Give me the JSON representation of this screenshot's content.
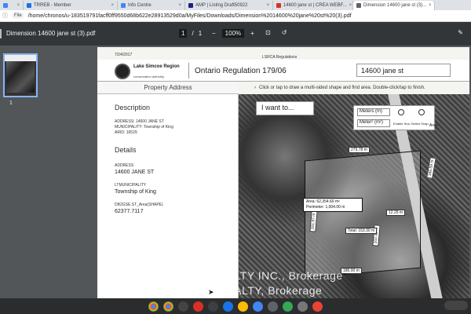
{
  "browser": {
    "tabs": [
      {
        "title": "",
        "color": "#4285f4"
      },
      {
        "title": "TRREB - Member",
        "color": "#1a73e8"
      },
      {
        "title": "Info Centre",
        "color": "#4285f4"
      },
      {
        "title": "AMP | Listing Draft50922",
        "color": "#1a237e"
      },
      {
        "title": "14600 jane st | CREA WEBF...",
        "color": "#d93025"
      },
      {
        "title": "Dimension 14600 jane st (3)...",
        "color": "#5f6368"
      }
    ],
    "address_prefix": "File",
    "address": "/home/chronos/u-183519791facff0ff9550d68b622e28913529d0a/MyFiles/Downloads/Dimension%2014600%20jane%20st%20(3).pdf"
  },
  "pdf": {
    "filename": "Dimension 14600 jane st (3).pdf",
    "page_current": "1",
    "page_sep": "/",
    "page_total": "1",
    "zoom": "100%",
    "zoom_minus": "−",
    "zoom_plus": "+",
    "thumb_label": "1"
  },
  "doc": {
    "date": "7/24/2017",
    "rb": "LSRCA Regulations",
    "org_line1": "Lake Simcoe Region",
    "org_line2": "conservation authority",
    "regulation": "Ontario Regulation 179/06",
    "search_value": "14600 jane st",
    "property_address_tab": "Property Address",
    "hint": "Click or tap to draw a multi-sided shape and find area. Double-click/tap to finish.",
    "description_heading": "Description",
    "desc_lines": [
      "ADDRESS: 14600 JANE ST",
      "MUNICIPALITY: Township of King",
      "ARID: 16529"
    ],
    "details_heading": "Details",
    "address_label": "ADDRESS",
    "address_value": "14600 JANE ST",
    "municipality_label": "LTMUNICIPALITY",
    "municipality_value": "Township of King",
    "area_label": "DB2GSE.ST_Area(SHAPE)",
    "area_value": "62377.7117",
    "i_want_to": "I want to...",
    "units_length": "Meters (m)",
    "units_area": "Meter² (m²)",
    "enable_snap": "Enable Sna...",
    "select_snap": "Select Snap...",
    "area_btn": "Area",
    "dims": {
      "top": "279.78 m",
      "right": "166.59 m",
      "left": "261.97 m",
      "bottom": "186.00 m",
      "right2": "12.29 m",
      "mid": "102.43 m",
      "total": "Total: 153.30 m"
    },
    "area_result": "Area: 62,354.60 m²",
    "perimeter_result": "Perimeter: 1,004.00 m"
  },
  "watermark": {
    "line1": "HOME CHOICE REALTY INC., Brokerage",
    "line2": "RIGHT AT HOME REALTY, Brokerage"
  }
}
